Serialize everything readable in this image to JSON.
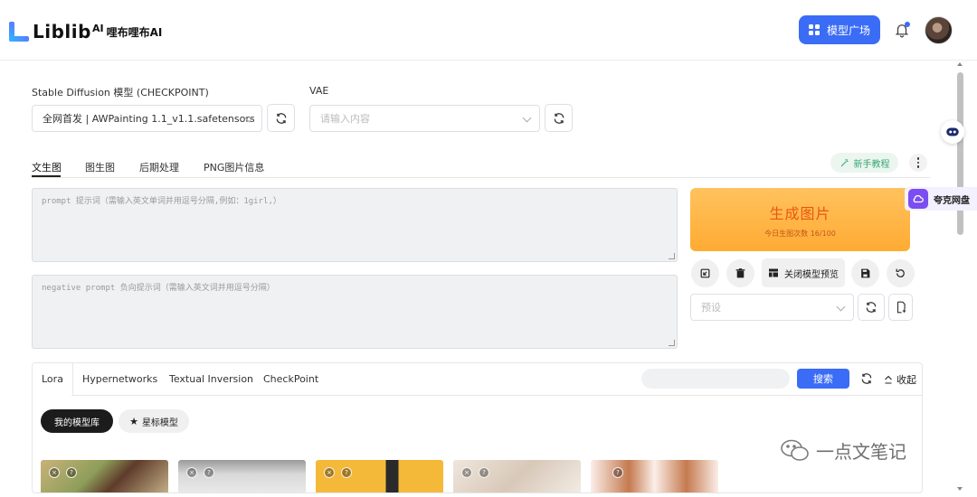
{
  "header": {
    "logo_text": "Liblib",
    "logo_sup": "AI",
    "logo_cn": "哩布哩布AI",
    "model_plaza_label": "模型广场"
  },
  "model_select": {
    "checkpoint_label": "Stable Diffusion 模型 (CHECKPOINT)",
    "checkpoint_value": "全网首发 | AWPainting 1.1_v1.1.safetensors",
    "vae_label": "VAE",
    "vae_placeholder": "请输入内容"
  },
  "tabs": [
    "文生图",
    "图生图",
    "后期处理",
    "PNG图片信息"
  ],
  "tutorial_label": "新手教程",
  "prompt_placeholder": "prompt 提示词（需输入英文单词并用逗号分隔,例如：1girl,）",
  "negative_placeholder": "negative prompt 负向提示词（需输入英文词并用逗号分隔）",
  "generate": {
    "title": "生成图片",
    "subtitle": "今日生图次数 16/100"
  },
  "close_preview_label": "关闭模型预览",
  "preset_placeholder": "预设",
  "panel": {
    "tabs": [
      "Lora",
      "Hypernetworks",
      "Textual Inversion",
      "CheckPoint"
    ],
    "search_label": "搜索",
    "collapse_label": "收起",
    "my_models_label": "我的模型库",
    "starred_label": "星标模型"
  },
  "side": {
    "quark_label": "夸克网盘"
  },
  "watermark": "一点文笔记",
  "colors": {
    "primary": "#3b6cf6",
    "generate_bg": "#ffb23f",
    "generate_text": "#e8570f",
    "tutorial_text": "#3aa574"
  }
}
